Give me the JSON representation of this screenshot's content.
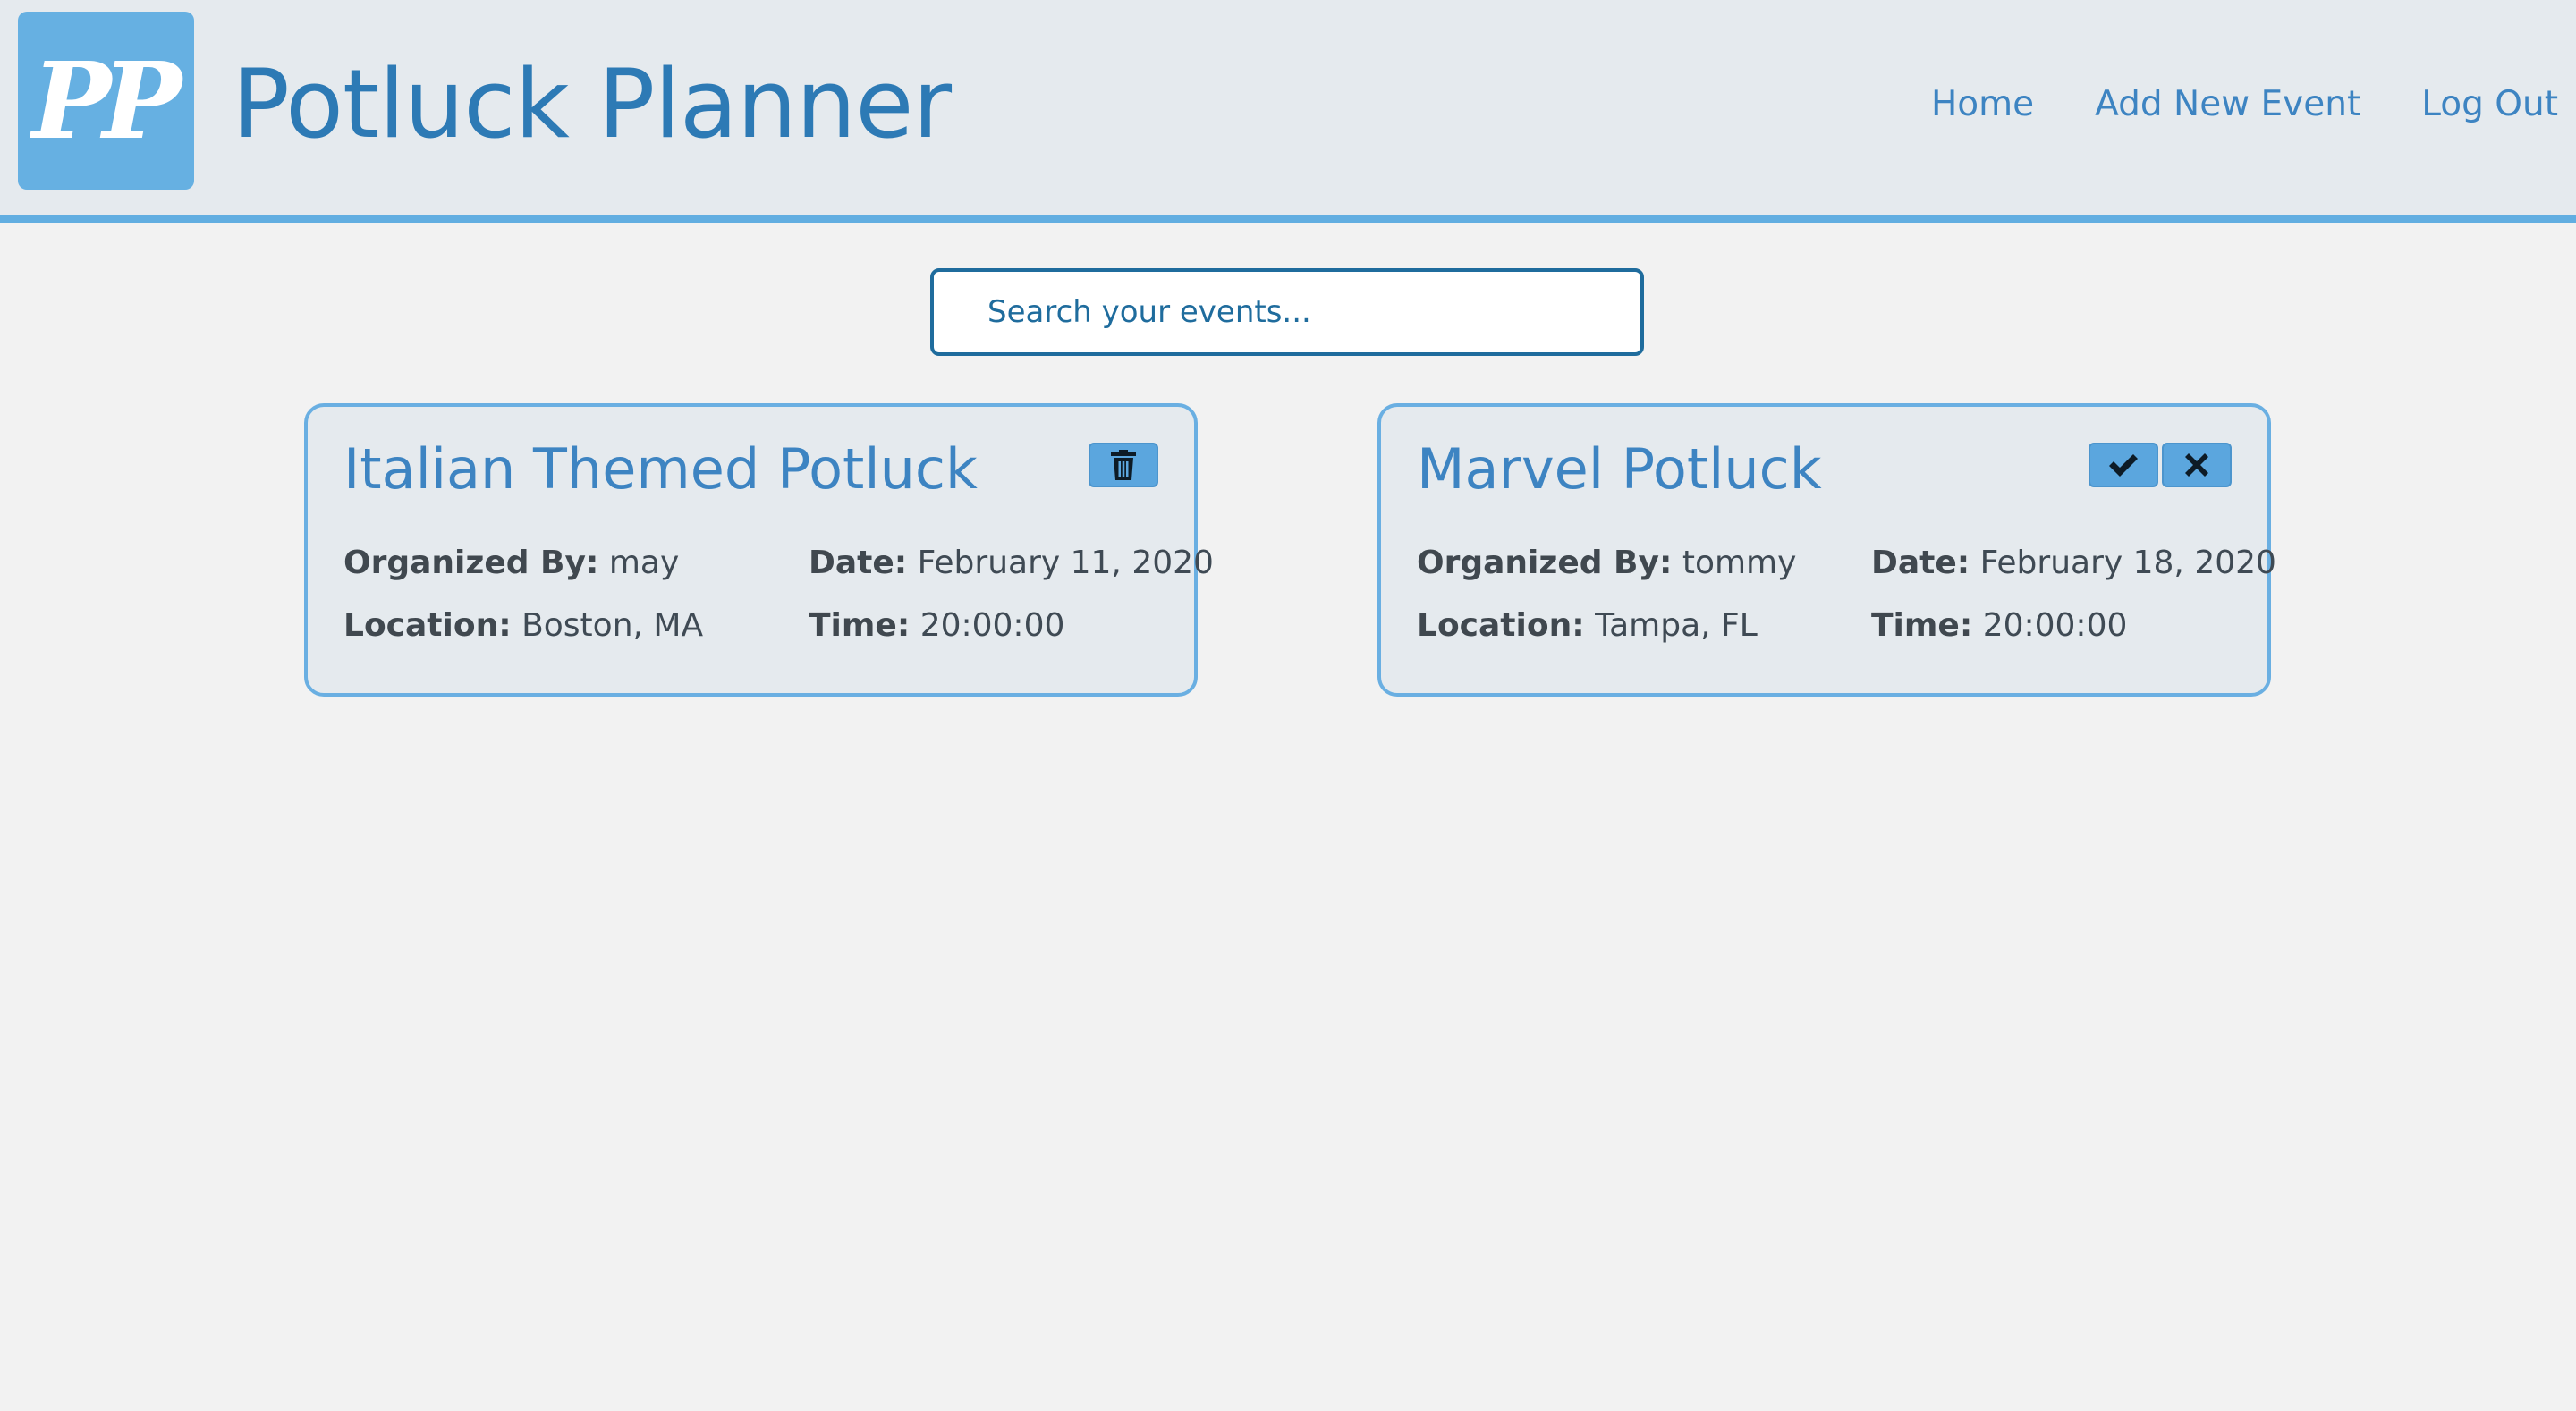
{
  "app": {
    "logo_text": "PP",
    "title": "Potluck Planner"
  },
  "nav": {
    "home": "Home",
    "add_new_event": "Add New Event",
    "log_out": "Log Out"
  },
  "search": {
    "placeholder": "Search your events...",
    "value": ""
  },
  "labels": {
    "organized_by": "Organized By:",
    "date": "Date:",
    "location": "Location:",
    "time": "Time:"
  },
  "events": [
    {
      "title": "Italian Themed Potluck",
      "organizer": "may",
      "date": "February 11, 2020",
      "location": "Boston, MA",
      "time": "20:00:00",
      "actions": [
        "trash-icon"
      ]
    },
    {
      "title": "Marvel Potluck",
      "organizer": "tommy",
      "date": "February 18, 2020",
      "location": "Tampa, FL",
      "time": "20:00:00",
      "actions": [
        "check-icon",
        "close-icon"
      ]
    }
  ],
  "colors": {
    "brand": "#62aee1",
    "title_text": "#2d7ab5",
    "link": "#3d84c2",
    "header_bg": "#e5eaee",
    "page_bg": "#f2f2f2",
    "search_border": "#1f6c9d"
  }
}
